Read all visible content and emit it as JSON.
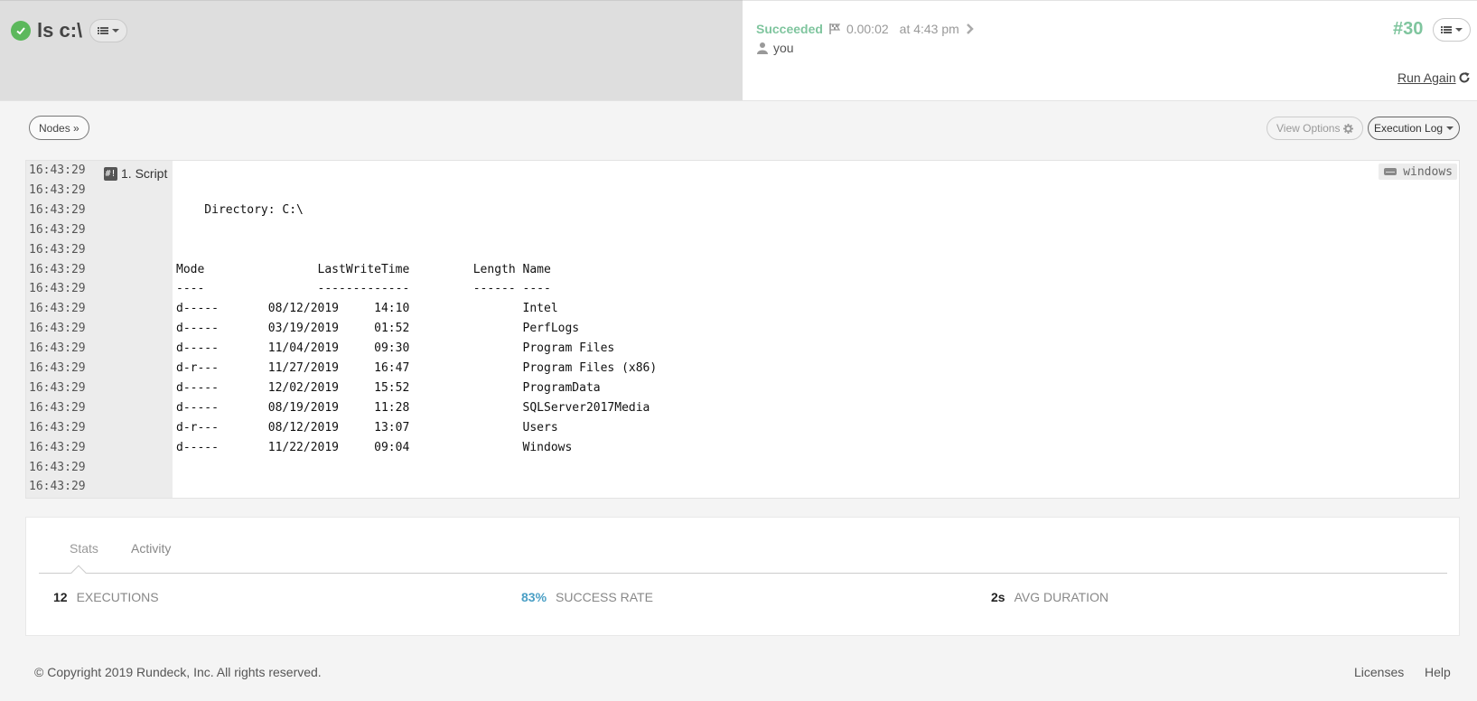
{
  "header": {
    "job_name": "ls c:\\",
    "status": "Succeeded",
    "duration": "0.00:02",
    "time": "at 4:43 pm",
    "user": "you",
    "execution_number": "#30",
    "run_again_label": "Run Again"
  },
  "toolbar": {
    "nodes_label": "Nodes »",
    "view_options_label": "View Options",
    "log_view_label": "Execution Log"
  },
  "log": {
    "step_label": "1. Script",
    "node_name": "windows",
    "lines": [
      {
        "ts": "16:43:29",
        "text": ""
      },
      {
        "ts": "16:43:29",
        "text": ""
      },
      {
        "ts": "16:43:29",
        "text": "    Directory: C:\\"
      },
      {
        "ts": "16:43:29",
        "text": ""
      },
      {
        "ts": "16:43:29",
        "text": ""
      },
      {
        "ts": "16:43:29",
        "text": "Mode                LastWriteTime         Length Name"
      },
      {
        "ts": "16:43:29",
        "text": "----                -------------         ------ ----"
      },
      {
        "ts": "16:43:29",
        "text": "d-----       08/12/2019     14:10                Intel"
      },
      {
        "ts": "16:43:29",
        "text": "d-----       03/19/2019     01:52                PerfLogs"
      },
      {
        "ts": "16:43:29",
        "text": "d-----       11/04/2019     09:30                Program Files"
      },
      {
        "ts": "16:43:29",
        "text": "d-r---       11/27/2019     16:47                Program Files (x86)"
      },
      {
        "ts": "16:43:29",
        "text": "d-----       12/02/2019     15:52                ProgramData"
      },
      {
        "ts": "16:43:29",
        "text": "d-----       08/19/2019     11:28                SQLServer2017Media"
      },
      {
        "ts": "16:43:29",
        "text": "d-r---       08/12/2019     13:07                Users"
      },
      {
        "ts": "16:43:29",
        "text": "d-----       11/22/2019     09:04                Windows"
      },
      {
        "ts": "16:43:29",
        "text": ""
      },
      {
        "ts": "16:43:29",
        "text": ""
      }
    ]
  },
  "stats": {
    "tabs": [
      "Stats",
      "Activity"
    ],
    "executions_value": "12",
    "executions_label": "EXECUTIONS",
    "success_value": "83%",
    "success_label": "SUCCESS RATE",
    "duration_value": "2s",
    "duration_label": "AVG DURATION"
  },
  "footer": {
    "copyright": "© Copyright 2019 Rundeck, Inc. All rights reserved.",
    "links": [
      "Licenses",
      "Help"
    ]
  },
  "colors": {
    "success": "#7fc59e",
    "ok_icon": "#5cb85c",
    "rate": "#4a9fc5"
  }
}
